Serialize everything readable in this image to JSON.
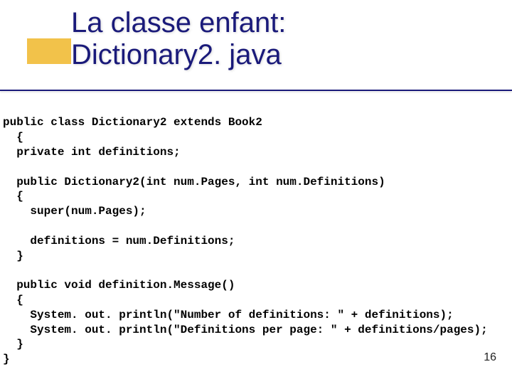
{
  "slide": {
    "title_line1": "La classe enfant:",
    "title_line2": "Dictionary2. java",
    "page_number": "16"
  },
  "code": {
    "l01": "public class Dictionary2 extends Book2",
    "l02": "  {",
    "l03": "  private int definitions;",
    "l04": "",
    "l05": "  public Dictionary2(int num.Pages, int num.Definitions)",
    "l06": "  {",
    "l07": "    super(num.Pages);",
    "l08": "",
    "l09": "    definitions = num.Definitions;",
    "l10": "  }",
    "l11": "",
    "l12": "  public void definition.Message()",
    "l13": "  {",
    "l14": "    System. out. println(\"Number of definitions: \" + definitions);",
    "l15": "    System. out. println(\"Definitions per page: \" + definitions/pages);",
    "l16": "  }",
    "l17": "}"
  }
}
